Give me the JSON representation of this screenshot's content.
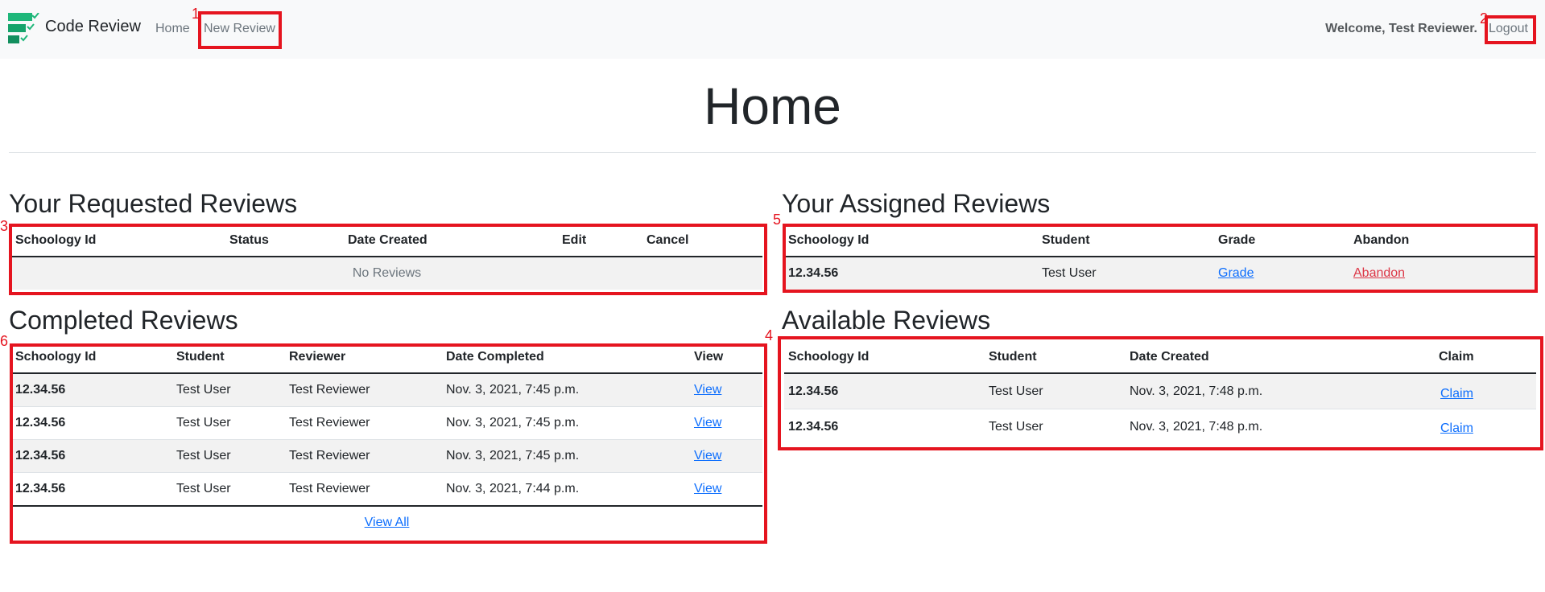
{
  "navbar": {
    "brand": "Code Review",
    "links": [
      "Home",
      "New Review"
    ],
    "welcome": "Welcome, Test Reviewer.",
    "logout": "Logout"
  },
  "page": {
    "title": "Home"
  },
  "requested": {
    "title": "Your Requested Reviews",
    "headers": [
      "Schoology Id",
      "Status",
      "Date Created",
      "Edit",
      "Cancel"
    ],
    "empty": "No Reviews"
  },
  "assigned": {
    "title": "Your Assigned Reviews",
    "headers": [
      "Schoology Id",
      "Student",
      "Grade",
      "Abandon"
    ],
    "rows": [
      {
        "id": "12.34.56",
        "student": "Test User",
        "grade": "Grade",
        "abandon": "Abandon"
      }
    ]
  },
  "completed": {
    "title": "Completed Reviews",
    "headers": [
      "Schoology Id",
      "Student",
      "Reviewer",
      "Date Completed",
      "View"
    ],
    "rows": [
      {
        "id": "12.34.56",
        "student": "Test User",
        "reviewer": "Test Reviewer",
        "date": "Nov. 3, 2021, 7:45 p.m.",
        "view": "View"
      },
      {
        "id": "12.34.56",
        "student": "Test User",
        "reviewer": "Test Reviewer",
        "date": "Nov. 3, 2021, 7:45 p.m.",
        "view": "View"
      },
      {
        "id": "12.34.56",
        "student": "Test User",
        "reviewer": "Test Reviewer",
        "date": "Nov. 3, 2021, 7:45 p.m.",
        "view": "View"
      },
      {
        "id": "12.34.56",
        "student": "Test User",
        "reviewer": "Test Reviewer",
        "date": "Nov. 3, 2021, 7:44 p.m.",
        "view": "View"
      }
    ],
    "view_all": "View All"
  },
  "available": {
    "title": "Available Reviews",
    "headers": [
      "Schoology Id",
      "Student",
      "Date Created",
      "Claim"
    ],
    "rows": [
      {
        "id": "12.34.56",
        "student": "Test User",
        "date": "Nov. 3, 2021, 7:48 p.m.",
        "claim": "Claim"
      },
      {
        "id": "12.34.56",
        "student": "Test User",
        "date": "Nov. 3, 2021, 7:48 p.m.",
        "claim": "Claim"
      }
    ]
  },
  "annotations": [
    "1",
    "2",
    "3",
    "4",
    "5",
    "6"
  ],
  "colors": {
    "annotation": "#e5141f",
    "link": "#0d6efd",
    "danger": "#dc3545",
    "navbar_bg": "#f8f9fa",
    "brand_green": "#1fb77a"
  }
}
